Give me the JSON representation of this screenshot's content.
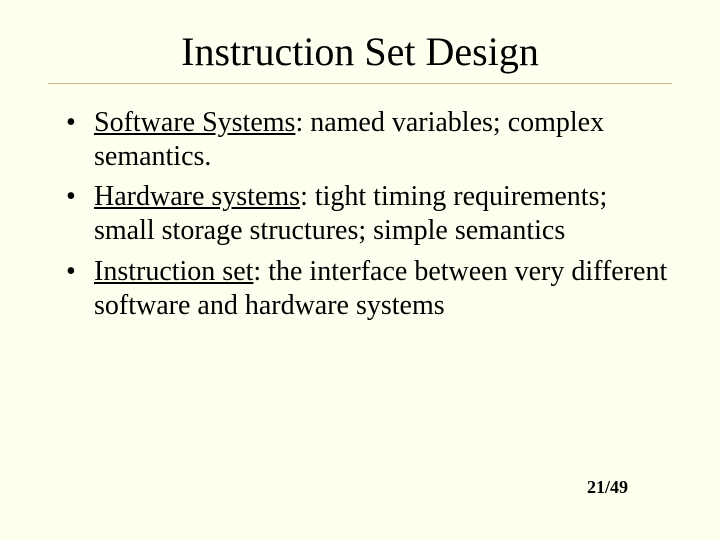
{
  "title": "Instruction Set Design",
  "bullets": [
    {
      "lead": "Software Systems",
      "rest": ": named variables; complex semantics."
    },
    {
      "lead": "Hardware systems",
      "rest": ": tight timing requirements; small storage structures; simple semantics"
    },
    {
      "lead": "Instruction set",
      "rest": ": the interface between very different software and hardware systems"
    }
  ],
  "page": "21/49"
}
